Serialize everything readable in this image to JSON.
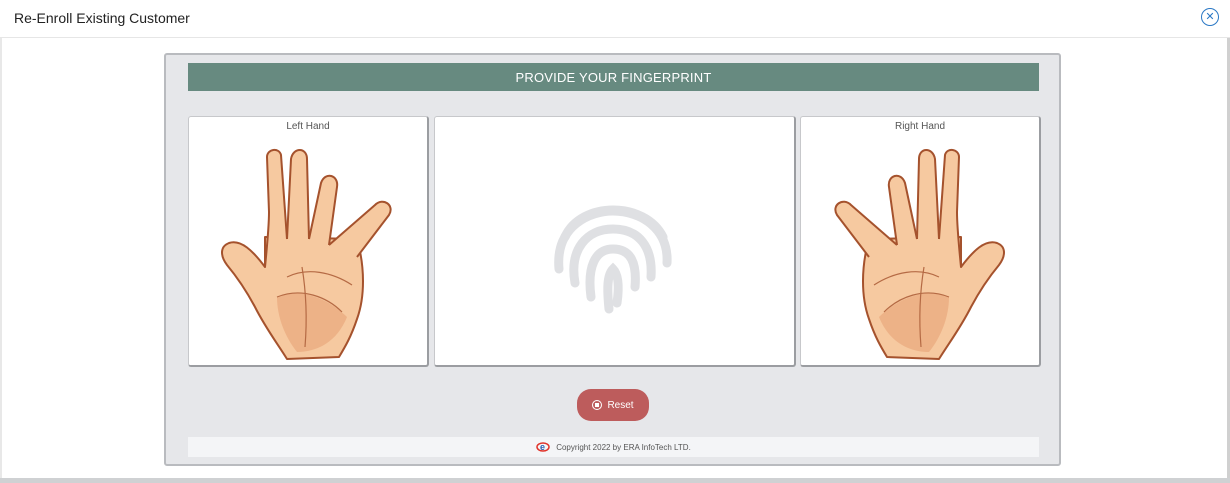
{
  "modal": {
    "title": "Re-Enroll Existing Customer",
    "close_icon": "close-circle-icon"
  },
  "panel": {
    "heading": "PROVIDE YOUR FINGERPRINT",
    "left_label": "Left Hand",
    "right_label": "Right Hand",
    "center_icon": "fingerprint-icon",
    "reset_label": "Reset",
    "reset_icon": "stop-circle-icon",
    "footer_text": "Copyright 2022 by ERA InfoTech LTD.",
    "footer_logo": "era-infotech-logo"
  },
  "colors": {
    "banner": "#678a80",
    "reset": "#bd5c5c",
    "panel_bg": "#e6e7ea",
    "accent_blue": "#2b78c5"
  }
}
